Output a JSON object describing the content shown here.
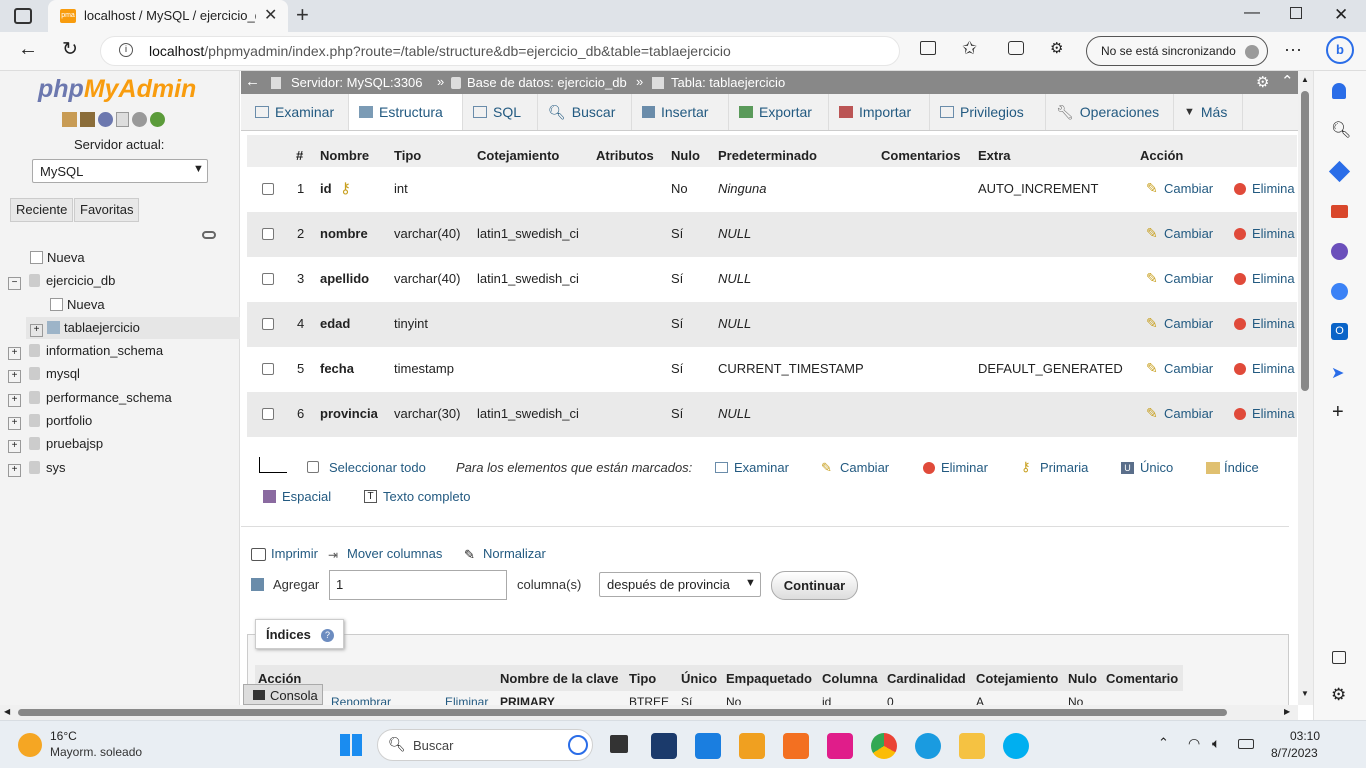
{
  "browser": {
    "tab_title": "localhost / MySQL / ejercicio_db",
    "url_host": "localhost",
    "url_path": "/phpmyadmin/index.php?route=/table/structure&db=ejercicio_db&table=tablaejercicio",
    "sync_label": "No se está sincronizando"
  },
  "left": {
    "logo_php": "php",
    "logo_myadmin": "MyAdmin",
    "server_label": "Servidor actual:",
    "server_value": "MySQL",
    "tab_recent": "Reciente",
    "tab_favorites": "Favoritas",
    "tree": {
      "new_top": "Nueva",
      "db1": "ejercicio_db",
      "new_in_db": "Nueva",
      "table1": "tablaejercicio",
      "db2": "information_schema",
      "db3": "mysql",
      "db4": "performance_schema",
      "db5": "portfolio",
      "db6": "pruebajsp",
      "db7": "sys"
    }
  },
  "breadcrumb": {
    "server": "Servidor: MySQL:3306",
    "database": "Base de datos: ejercicio_db",
    "table": "Tabla: tablaejercicio"
  },
  "tabs": {
    "browse": "Examinar",
    "structure": "Estructura",
    "sql": "SQL",
    "search": "Buscar",
    "insert": "Insertar",
    "export": "Exportar",
    "import": "Importar",
    "privileges": "Privilegios",
    "operations": "Operaciones",
    "more": "Más"
  },
  "structure": {
    "headers": {
      "num": "#",
      "name": "Nombre",
      "type": "Tipo",
      "collation": "Cotejamiento",
      "attributes": "Atributos",
      "null": "Nulo",
      "default": "Predeterminado",
      "comments": "Comentarios",
      "extra": "Extra",
      "action": "Acción"
    },
    "rows": [
      {
        "num": "1",
        "name": "id",
        "type": "int",
        "collation": "",
        "null": "No",
        "default": "Ninguna",
        "extra": "AUTO_INCREMENT",
        "change": "Cambiar",
        "drop": "Elimina"
      },
      {
        "num": "2",
        "name": "nombre",
        "type": "varchar(40)",
        "collation": "latin1_swedish_ci",
        "null": "Sí",
        "default": "NULL",
        "extra": "",
        "change": "Cambiar",
        "drop": "Elimina"
      },
      {
        "num": "3",
        "name": "apellido",
        "type": "varchar(40)",
        "collation": "latin1_swedish_ci",
        "null": "Sí",
        "default": "NULL",
        "extra": "",
        "change": "Cambiar",
        "drop": "Elimina"
      },
      {
        "num": "4",
        "name": "edad",
        "type": "tinyint",
        "collation": "",
        "null": "Sí",
        "default": "NULL",
        "extra": "",
        "change": "Cambiar",
        "drop": "Elimina"
      },
      {
        "num": "5",
        "name": "fecha",
        "type": "timestamp",
        "collation": "",
        "null": "Sí",
        "default": "CURRENT_TIMESTAMP",
        "extra": "DEFAULT_GENERATED",
        "change": "Cambiar",
        "drop": "Elimina"
      },
      {
        "num": "6",
        "name": "provincia",
        "type": "varchar(30)",
        "collation": "latin1_swedish_ci",
        "null": "Sí",
        "default": "NULL",
        "extra": "",
        "change": "Cambiar",
        "drop": "Elimina"
      }
    ]
  },
  "bulk": {
    "select_all": "Seleccionar todo",
    "marked_label": "Para los elementos que están marcados:",
    "browse": "Examinar",
    "change": "Cambiar",
    "drop": "Eliminar",
    "primary": "Primaria",
    "unique": "Único",
    "index": "Índice",
    "spatial": "Espacial",
    "fulltext": "Texto completo"
  },
  "tools": {
    "print": "Imprimir",
    "move_columns": "Mover columnas",
    "normalize": "Normalizar",
    "add_label": "Agregar",
    "add_value": "1",
    "columns_label": "columna(s)",
    "position_value": "después de provincia",
    "continue": "Continuar"
  },
  "indexes": {
    "legend": "Índices",
    "headers": {
      "action": "Acción",
      "key_name": "Nombre de la clave",
      "type": "Tipo",
      "unique": "Único",
      "packed": "Empaquetado",
      "column": "Columna",
      "cardinality": "Cardinalidad",
      "collation": "Cotejamiento",
      "null": "Nulo",
      "comment": "Comentario"
    },
    "row_partial": {
      "rename": "Renombrar",
      "drop": "Eliminar",
      "key": "PRIMARY",
      "type": "BTREE",
      "unique": "Sí",
      "packed": "No",
      "column": "id",
      "cardinality": "0",
      "collation": "A",
      "null": "No"
    }
  },
  "console_label": "Consola",
  "taskbar": {
    "weather_temp": "16°C",
    "weather_desc": "Mayorm. soleado",
    "search_label": "Buscar",
    "time": "03:10",
    "date": "8/7/2023"
  },
  "colors": {
    "link": "#235a81",
    "pma_orange": "#f89c0e",
    "pma_blue": "#6c78af",
    "breadcrumb_bg": "#888888"
  }
}
